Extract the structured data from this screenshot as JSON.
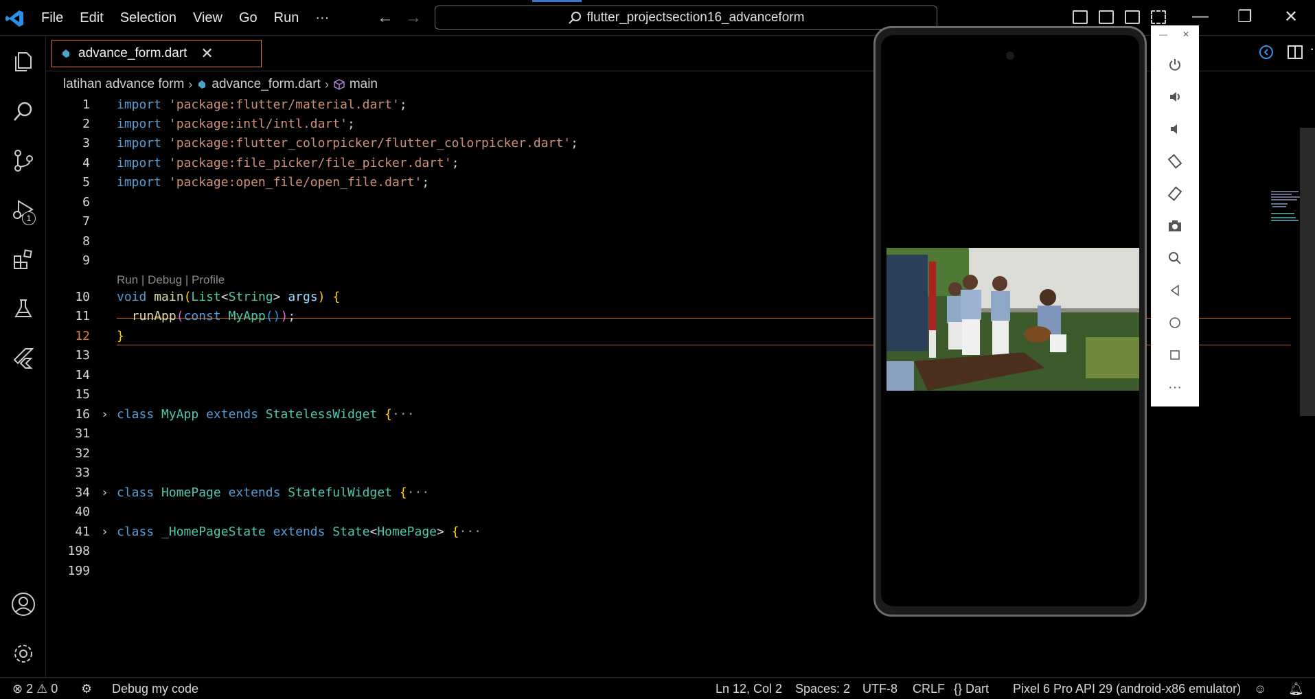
{
  "titlebar": {
    "menu": [
      "File",
      "Edit",
      "Selection",
      "View",
      "Go",
      "Run",
      "···"
    ],
    "search_text": "flutter_projectsection16_advanceform"
  },
  "activitybar": {
    "items": [
      "files-icon",
      "search-icon",
      "source-control-icon",
      "run-debug-icon",
      "extensions-icon",
      "testing-icon",
      "flutter-icon"
    ],
    "debug_badge": "1",
    "bottom": [
      "account-icon",
      "settings-gear-icon"
    ]
  },
  "tabs": [
    {
      "label": "advance_form.dart",
      "active": true
    }
  ],
  "breadcrumb": {
    "folder": "latihan advance form",
    "file": "advance_form.dart",
    "symbol": "main"
  },
  "editor": {
    "current_line": 12,
    "codelens": "Run | Debug | Profile",
    "lines": [
      {
        "n": "1",
        "text": "import 'package:flutter/material.dart';"
      },
      {
        "n": "2",
        "text": "import 'package:intl/intl.dart';"
      },
      {
        "n": "3",
        "text": "import 'package:flutter_colorpicker/flutter_colorpicker.dart';"
      },
      {
        "n": "4",
        "text": "import 'package:file_picker/file_picker.dart';"
      },
      {
        "n": "5",
        "text": "import 'package:open_file/open_file.dart';"
      },
      {
        "n": "6",
        "text": ""
      },
      {
        "n": "7",
        "text": ""
      },
      {
        "n": "8",
        "text": ""
      },
      {
        "n": "9",
        "text": ""
      },
      {
        "n": "10",
        "text": "void main(List<String> args) {"
      },
      {
        "n": "11",
        "text": "  runApp(const MyApp());"
      },
      {
        "n": "12",
        "text": "}"
      },
      {
        "n": "13",
        "text": ""
      },
      {
        "n": "14",
        "text": ""
      },
      {
        "n": "15",
        "text": ""
      },
      {
        "n": "16",
        "text": "class MyApp extends StatelessWidget {···"
      },
      {
        "n": "31",
        "text": ""
      },
      {
        "n": "32",
        "text": ""
      },
      {
        "n": "33",
        "text": ""
      },
      {
        "n": "34",
        "text": "class HomePage extends StatefulWidget {···"
      },
      {
        "n": "40",
        "text": ""
      },
      {
        "n": "41",
        "text": "class _HomePageState extends State<HomePage> {···"
      },
      {
        "n": "198",
        "text": ""
      },
      {
        "n": "199",
        "text": ""
      }
    ]
  },
  "emulator": {
    "controls": [
      "power-icon",
      "volume-up-icon",
      "volume-down-icon",
      "rotate-left-icon",
      "rotate-right-icon",
      "camera-icon",
      "zoom-icon",
      "back-icon",
      "home-icon",
      "overview-icon",
      "more-icon"
    ]
  },
  "statusbar": {
    "errors": "2",
    "warnings": "0",
    "debug": "Debug my code",
    "position": "Ln 12, Col 2",
    "spaces": "Spaces: 2",
    "encoding": "UTF-8",
    "eol": "CRLF",
    "language": "{} Dart",
    "device": "Pixel 6 Pro API 29 (android-x86 emulator)"
  },
  "colors": {
    "accent": "#e07a30",
    "keyword": "#569cd6",
    "string": "#ce9178",
    "class": "#4ec9b0",
    "function": "#dcdcaa"
  }
}
